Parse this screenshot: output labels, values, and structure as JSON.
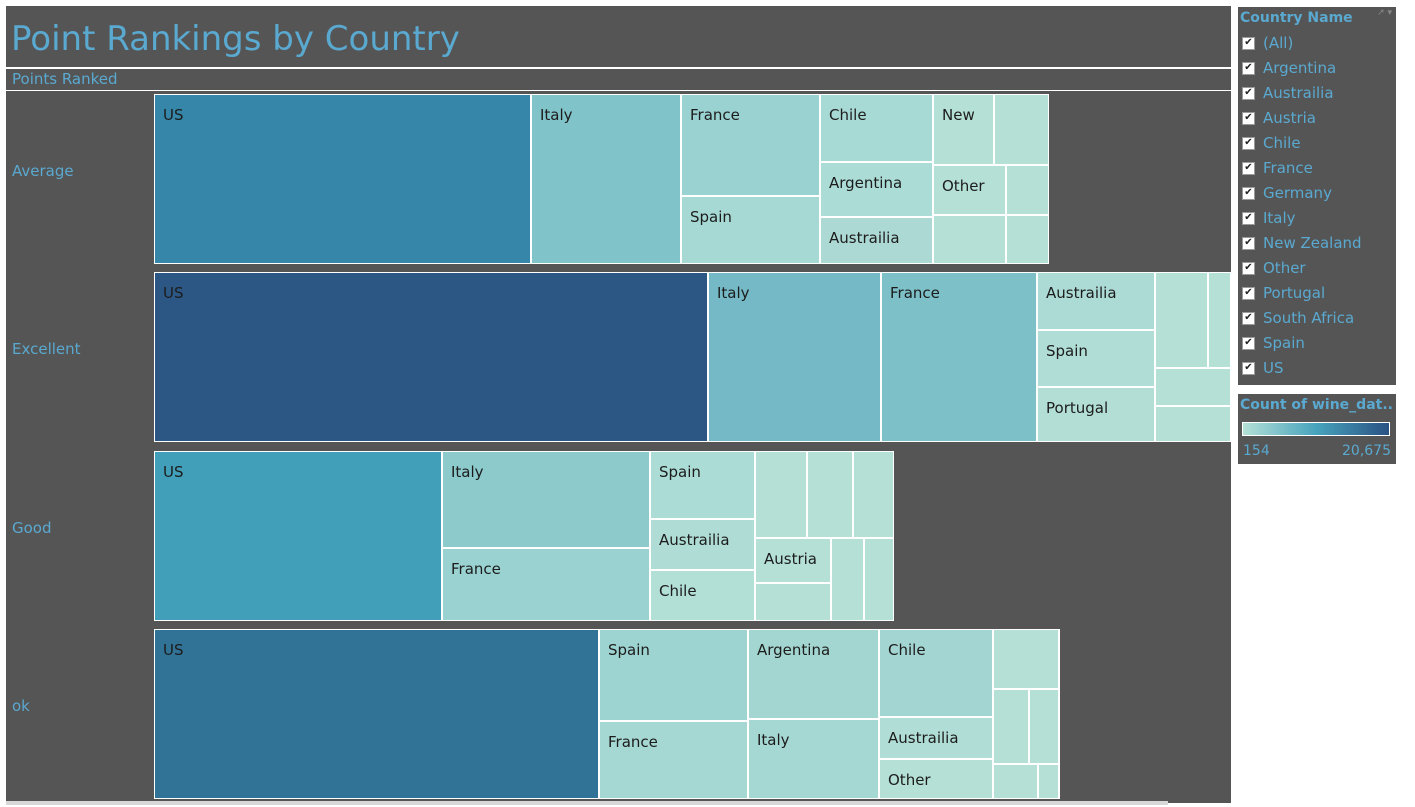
{
  "title": "Point Rankings by Country",
  "header_label": "Points Ranked",
  "colors": {
    "panel": "#555555",
    "label": "#5aa9d0",
    "ramp_low": "#b4e0d6",
    "ramp_mid": "#47a3bd",
    "ramp_high": "#2a5283"
  },
  "filter": {
    "title": "Country Name",
    "tools": "↗ ▾",
    "check_mark": "✔",
    "items": [
      "(All)",
      "Argentina",
      "Austrailia",
      "Austria",
      "Chile",
      "France",
      "Germany",
      "Italy",
      "New Zealand",
      "Other",
      "Portugal",
      "South Africa",
      "Spain",
      "US"
    ]
  },
  "legend": {
    "title": "Count of wine_dat...",
    "min": "154",
    "max": "20,675"
  },
  "chart_data": {
    "type": "treemap",
    "title": "Point Rankings by Country",
    "row_dimension": "Points Ranked",
    "measure": "Count of wine_dat...",
    "color_range": [
      154,
      20675
    ],
    "rows": [
      {
        "label": "Average",
        "cells": [
          {
            "name": "US",
            "label": "US",
            "color": "#3586a8"
          },
          {
            "name": "Italy",
            "label": "Italy",
            "color": "#80c3c9"
          },
          {
            "name": "France",
            "label": "France",
            "color": "#9ad2d1"
          },
          {
            "name": "Spain",
            "label": "Spain",
            "color": "#a6d9d4"
          },
          {
            "name": "Chile",
            "label": "Chile",
            "color": "#a8dad5"
          },
          {
            "name": "Argentina",
            "label": "Argentina",
            "color": "#abdcd6"
          },
          {
            "name": "Austrailia",
            "label": "Austrailia",
            "color": "#add9d4"
          },
          {
            "name": "New Zealand",
            "label": "New",
            "color": "#b4e0d6"
          },
          {
            "name": "unlabeled",
            "label": "",
            "color": "#b4e0d6"
          },
          {
            "name": "Other",
            "label": "Other",
            "color": "#b4e0d6"
          },
          {
            "name": "unlabeled",
            "label": "",
            "color": "#b4e0d6"
          },
          {
            "name": "unlabeled",
            "label": "",
            "color": "#b4e0d6"
          },
          {
            "name": "unlabeled",
            "label": "",
            "color": "#b4e0d6"
          }
        ]
      },
      {
        "label": "Excellent",
        "cells": [
          {
            "name": "US",
            "label": "US",
            "color": "#2c5785"
          },
          {
            "name": "Italy",
            "label": "Italy",
            "color": "#74b9c5"
          },
          {
            "name": "France",
            "label": "France",
            "color": "#7dc0c8"
          },
          {
            "name": "Austrailia",
            "label": "Austrailia",
            "color": "#acdad5"
          },
          {
            "name": "Spain",
            "label": "Spain",
            "color": "#b0ddd6"
          },
          {
            "name": "Portugal",
            "label": "Portugal",
            "color": "#b2ded6"
          },
          {
            "name": "unlabeled",
            "label": "",
            "color": "#b4e0d6"
          },
          {
            "name": "unlabeled",
            "label": "",
            "color": "#b4e0d6"
          },
          {
            "name": "unlabeled",
            "label": "",
            "color": "#b4e0d6"
          },
          {
            "name": "unlabeled",
            "label": "",
            "color": "#b4e0d6"
          }
        ]
      },
      {
        "label": "Good",
        "cells": [
          {
            "name": "US",
            "label": "US",
            "color": "#429fb9"
          },
          {
            "name": "Italy",
            "label": "Italy",
            "color": "#8ccacc"
          },
          {
            "name": "France",
            "label": "France",
            "color": "#9ad2d1"
          },
          {
            "name": "Spain",
            "label": "Spain",
            "color": "#abdcd5"
          },
          {
            "name": "Austrailia",
            "label": "Austrailia",
            "color": "#afddd5"
          },
          {
            "name": "Chile",
            "label": "Chile",
            "color": "#b2dfd6"
          },
          {
            "name": "unlabeled",
            "label": "",
            "color": "#b4e0d6"
          },
          {
            "name": "unlabeled",
            "label": "",
            "color": "#b4e0d6"
          },
          {
            "name": "unlabeled",
            "label": "",
            "color": "#b4e0d6"
          },
          {
            "name": "Austria",
            "label": "Austria",
            "color": "#b4e0d6"
          },
          {
            "name": "unlabeled",
            "label": "",
            "color": "#b4e0d6"
          },
          {
            "name": "unlabeled",
            "label": "",
            "color": "#b4e0d6"
          },
          {
            "name": "unlabeled",
            "label": "",
            "color": "#b4e0d6"
          }
        ]
      },
      {
        "label": "ok",
        "cells": [
          {
            "name": "US",
            "label": "US",
            "color": "#317396"
          },
          {
            "name": "Spain",
            "label": "Spain",
            "color": "#9dd3d0"
          },
          {
            "name": "France",
            "label": "France",
            "color": "#a6d8d3"
          },
          {
            "name": "Argentina",
            "label": "Argentina",
            "color": "#a3d6d1"
          },
          {
            "name": "Italy",
            "label": "Italy",
            "color": "#a6d8d3"
          },
          {
            "name": "Chile",
            "label": "Chile",
            "color": "#a3d6d2"
          },
          {
            "name": "Austrailia",
            "label": "Austrailia",
            "color": "#b0ddd5"
          },
          {
            "name": "Other",
            "label": "Other",
            "color": "#b4e0d6"
          },
          {
            "name": "unlabeled",
            "label": "",
            "color": "#b4e0d6"
          },
          {
            "name": "unlabeled",
            "label": "",
            "color": "#b4e0d6"
          },
          {
            "name": "unlabeled",
            "label": "",
            "color": "#b4e0d6"
          },
          {
            "name": "unlabeled",
            "label": "",
            "color": "#b4e0d6"
          },
          {
            "name": "unlabeled",
            "label": "",
            "color": "#b4e0d6"
          }
        ]
      }
    ]
  }
}
